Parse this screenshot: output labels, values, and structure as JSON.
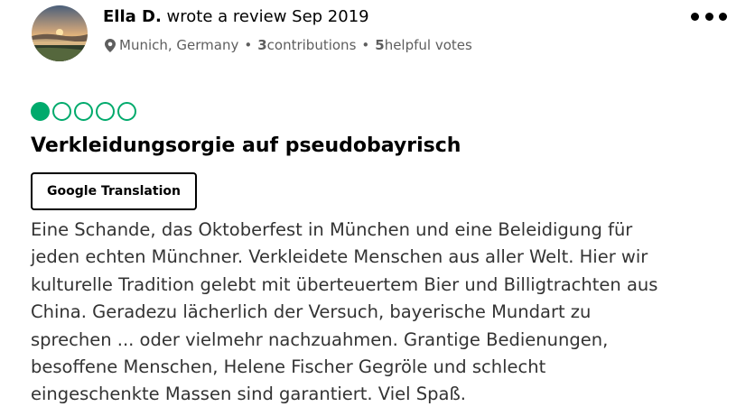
{
  "reviewer": {
    "name": "Ella D.",
    "action": " wrote a review ",
    "date": "Sep 2019",
    "location": "Munich, Germany",
    "contributions_count": "3",
    "contributions_label": " contributions",
    "helpful_count": "5",
    "helpful_label": " helpful votes",
    "separator": "•"
  },
  "review": {
    "rating": 1,
    "rating_max": 5,
    "title": "Verkleidungsorgie auf pseudobayrisch",
    "translate_label": "Google Translation",
    "body_lines": [
      "Eine Schande, das Oktoberfest in München und eine Beleidigung für",
      "jeden echten Münchner. Verkleidete Menschen aus aller Welt. Hier wir",
      "kulturelle Tradition gelebt mit überteuertem Bier und Billigtrachten aus",
      "China. Geradezu lächerlich der Versuch, bayerische Mundart zu",
      "sprechen ... oder vielmehr nachzuahmen. Grantige Bedienungen,",
      "besoffene Menschen, Helene Fischer Gegröle und schlecht",
      "eingeschenkte Massen sind garantiert. Viel Spaß."
    ]
  },
  "icons": {
    "location": "map-pin-icon",
    "more": "more-options-icon",
    "rating_bubble": "rating-bubble-icon"
  },
  "colors": {
    "rating_green": "#00aa6c",
    "meta_gray": "#5e5e5e",
    "body_text": "#333333"
  }
}
